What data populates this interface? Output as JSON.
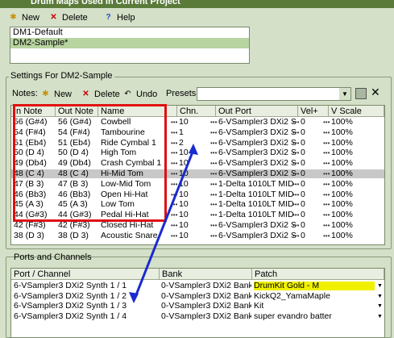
{
  "window": {
    "title": "Drum Maps Used in Current Project"
  },
  "maps_toolbar": {
    "new_label": "New",
    "delete_label": "Delete",
    "help_label": "Help"
  },
  "drum_maps": [
    {
      "label": "DM1-Default",
      "selected": false
    },
    {
      "label": "DM2-Sample*",
      "selected": true
    }
  ],
  "settings": {
    "title": "Settings For DM2-Sample",
    "notes_label": "Notes:",
    "new_label": "New",
    "delete_label": "Delete",
    "undo_label": "Undo",
    "presets_label": "Presets:",
    "presets_value": ""
  },
  "notes_table": {
    "headers": [
      "In Note",
      "Out Note",
      "Name",
      "Chn.",
      "Out Port",
      "Vel+",
      "V Scale"
    ],
    "rows": [
      [
        "56 (G#4)",
        "56 (G#4)",
        "Cowbell",
        "10",
        "6-VSampler3 DXi2 S",
        "0",
        "100%"
      ],
      [
        "54 (F#4)",
        "54 (F#4)",
        "Tambourine",
        "1",
        "6-VSampler3 DXi2 S",
        "0",
        "100%"
      ],
      [
        "51 (Eb4)",
        "51 (Eb4)",
        "Ride Cymbal 1",
        "2",
        "6-VSampler3 DXi2 S",
        "0",
        "100%"
      ],
      [
        "50 (D 4)",
        "50 (D 4)",
        "High Tom",
        "10",
        "6-VSampler3 DXi2 S",
        "0",
        "100%"
      ],
      [
        "49 (Db4)",
        "49 (Db4)",
        "Crash Cymbal 1",
        "10",
        "6-VSampler3 DXi2 S",
        "0",
        "100%"
      ],
      [
        "48 (C 4)",
        "48 (C 4)",
        "Hi-Mid Tom",
        "10",
        "6-VSampler3 DXi2 S",
        "0",
        "100%"
      ],
      [
        "47 (B 3)",
        "47 (B 3)",
        "Low-Mid Tom",
        "10",
        "1-Delta 1010LT MID",
        "0",
        "100%"
      ],
      [
        "46 (Bb3)",
        "46 (Bb3)",
        "Open Hi-Hat",
        "10",
        "1-Delta 1010LT MID",
        "0",
        "100%"
      ],
      [
        "45 (A 3)",
        "45 (A 3)",
        "Low Tom",
        "10",
        "1-Delta 1010LT MID",
        "0",
        "100%"
      ],
      [
        "44 (G#3)",
        "44 (G#3)",
        "Pedal Hi-Hat",
        "10",
        "1-Delta 1010LT MID",
        "0",
        "100%"
      ],
      [
        "42 (F#3)",
        "42 (F#3)",
        "Closed Hi-Hat",
        "10",
        "6-VSampler3 DXi2 S",
        "0",
        "100%"
      ],
      [
        "38 (D 3)",
        "38 (D 3)",
        "Acoustic Snare",
        "10",
        "6-VSampler3 DXi2 S",
        "0",
        "100%"
      ]
    ]
  },
  "ports": {
    "title": "Ports and Channels",
    "headers": [
      "Port / Channel",
      "Bank",
      "Patch"
    ],
    "rows": [
      [
        "6-VSampler3 DXi2 Synth 1 / 1",
        "0-VSampler3 DXi2 Bank",
        "DrumKit Gold - M"
      ],
      [
        "6-VSampler3 DXi2 Synth 1 / 2",
        "0-VSampler3 DXi2 Bank",
        "KickQ2_YamaMaple"
      ],
      [
        "6-VSampler3 DXi2 Synth 1 / 3",
        "0-VSampler3 DXi2 Bank",
        "Kit"
      ],
      [
        "6-VSampler3 DXi2 Synth 1 / 4",
        "0-VSampler3 DXi2 Bank",
        "super evandro batter"
      ]
    ]
  },
  "colors": {
    "highlight_box": "#e01010",
    "arrow": "#1a2ad0",
    "patch_highlight": "#f0f000"
  }
}
